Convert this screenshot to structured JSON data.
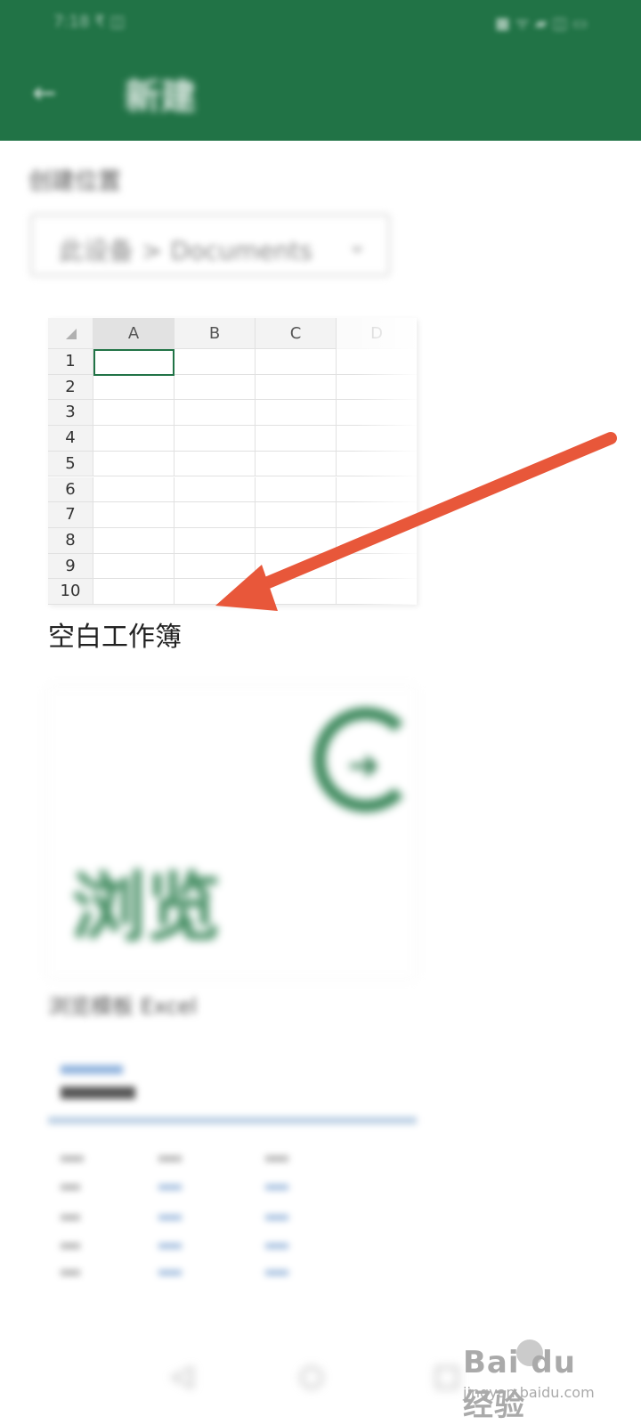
{
  "status_bar": {
    "left_text": "7:18 ₹ ◫",
    "right_text": "■ ᯤ ▰ ◫ ▭"
  },
  "header": {
    "back_label": "←",
    "title": "新建"
  },
  "save_location": {
    "label": "创建位置",
    "path": "此设备 > Documents",
    "chevron": "⌄"
  },
  "blank_workbook": {
    "columns": [
      "A",
      "B",
      "C",
      "D"
    ],
    "rows": [
      "1",
      "2",
      "3",
      "4",
      "5",
      "6",
      "7",
      "8",
      "9",
      "10"
    ],
    "label": "空白工作簿"
  },
  "browse": {
    "graphic_text": "浏览",
    "label": "浏览模板 Excel"
  },
  "template_preview": {
    "heading": "原始样本"
  },
  "nav": {
    "back": "◁",
    "home": "○",
    "recents": "□"
  },
  "watermark": {
    "brand": "Bai du 经验",
    "url": "jingyan.baidu.com"
  },
  "colors": {
    "brand_green": "#217346",
    "annotation_red": "#e8573a"
  }
}
